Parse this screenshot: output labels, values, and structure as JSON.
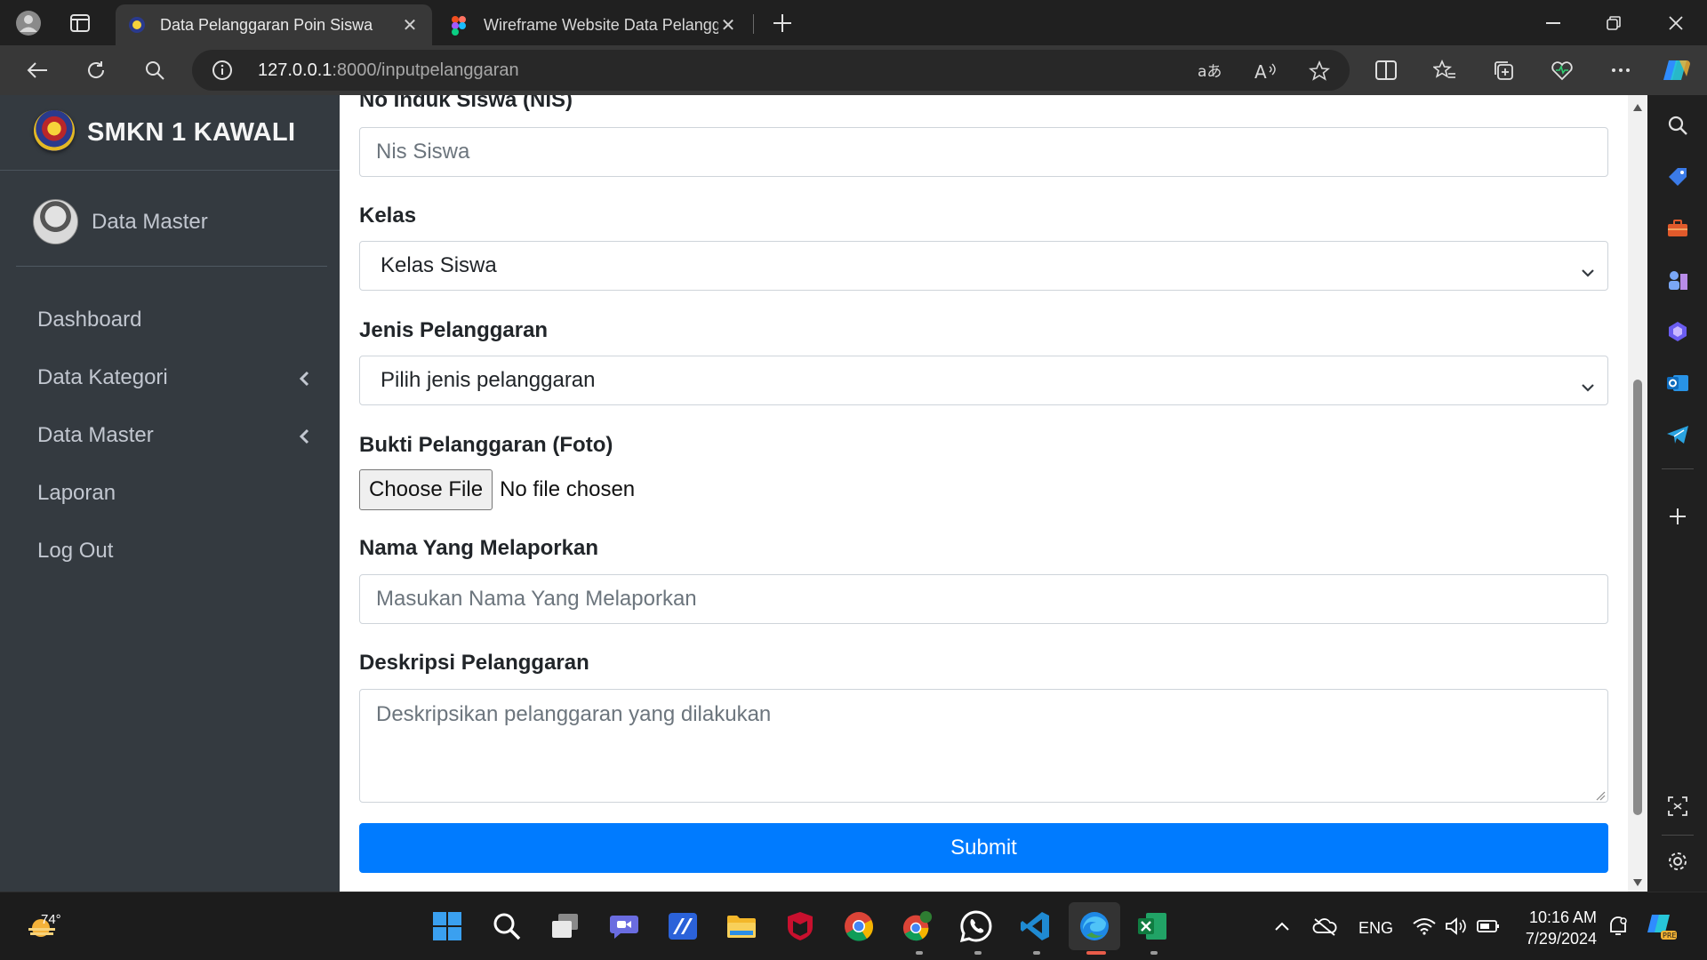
{
  "browser": {
    "tabs": [
      {
        "title": "Data Pelanggaran Poin Siswa",
        "active": true
      },
      {
        "title": "Wireframe Website Data Pelanggaran",
        "active": false
      }
    ],
    "address": {
      "host": "127.0.0.1",
      "rest": ":8000/inputpelanggaran"
    }
  },
  "sidebar": {
    "brand": "SMKN 1 KAWALI",
    "user": "Data Master",
    "items": [
      {
        "label": "Dashboard",
        "has_submenu": false
      },
      {
        "label": "Data Kategori",
        "has_submenu": true
      },
      {
        "label": "Data Master",
        "has_submenu": true
      },
      {
        "label": "Laporan",
        "has_submenu": false
      },
      {
        "label": "Log Out",
        "has_submenu": false
      }
    ]
  },
  "form": {
    "nis": {
      "label": "No Induk Siswa (NIS)",
      "placeholder": "Nis Siswa"
    },
    "kelas": {
      "label": "Kelas",
      "selected": "Kelas Siswa"
    },
    "jenis": {
      "label": "Jenis Pelanggaran",
      "selected": "Pilih jenis pelanggaran"
    },
    "bukti": {
      "label": "Bukti Pelanggaran (Foto)",
      "button": "Choose File",
      "status": "No file chosen"
    },
    "pelapor": {
      "label": "Nama Yang Melaporkan",
      "placeholder": "Masukan Nama Yang Melaporkan"
    },
    "deskripsi": {
      "label": "Deskripsi Pelanggaran",
      "placeholder": "Deskripsikan pelanggaran yang dilakukan"
    },
    "submit": "Submit"
  },
  "taskbar": {
    "weather_temp": "74°",
    "language": "ENG",
    "time": "10:16 AM",
    "date": "7/29/2024"
  },
  "colors": {
    "sidebar_bg": "#343a40",
    "primary": "#007bff",
    "browser_bg": "#202020",
    "toolbar_bg": "#383838"
  }
}
